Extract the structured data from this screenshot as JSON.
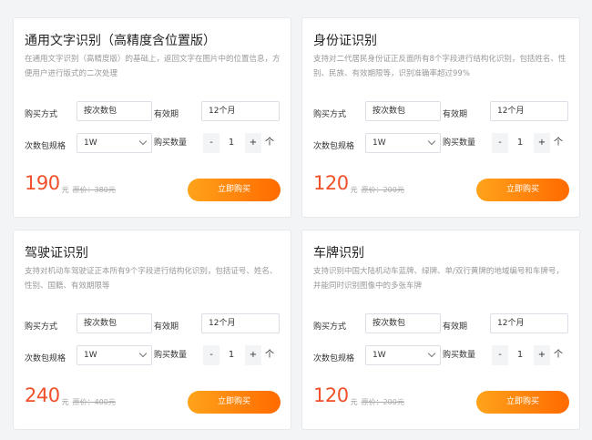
{
  "labels": {
    "buy_method": "购买方式",
    "validity": "有效期",
    "spec": "次数包规格",
    "quantity": "购买数量",
    "minus": "-",
    "plus": "+",
    "arrow": "个",
    "unit": "元",
    "buy_button": "立即购买"
  },
  "cards": [
    {
      "title": "通用文字识别（高精度含位置版）",
      "desc": "在通用文字识别（高精度版）的基础上，返回文字在图片中的位置信息，方便用户进行版式的二次处理",
      "buy_method": "按次数包",
      "validity": "12个月",
      "spec": "1W",
      "quantity": "1",
      "price": "190",
      "original": "原价：380元"
    },
    {
      "title": "身份证识别",
      "desc": "支持对二代居民身份证正反面所有8个字段进行结构化识别，包括姓名、性别、民族、有效期限等，识别准确率超过99%",
      "buy_method": "按次数包",
      "validity": "12个月",
      "spec": "1W",
      "quantity": "1",
      "price": "120",
      "original": "原价：200元"
    },
    {
      "title": "驾驶证识别",
      "desc": "支持对机动车驾驶证正本所有9个字段进行结构化识别，包括证号、姓名、性别、国籍、有效期限等",
      "buy_method": "按次数包",
      "validity": "12个月",
      "spec": "1W",
      "quantity": "1",
      "price": "240",
      "original": "原价：400元"
    },
    {
      "title": "车牌识别",
      "desc": "支持识别中国大陆机动车蓝牌、绿牌、单/双行黄牌的地域编号和车牌号，并能同时识别图像中的多张车牌",
      "buy_method": "按次数包",
      "validity": "12个月",
      "spec": "1W",
      "quantity": "1",
      "price": "120",
      "original": "原价：200元"
    }
  ]
}
